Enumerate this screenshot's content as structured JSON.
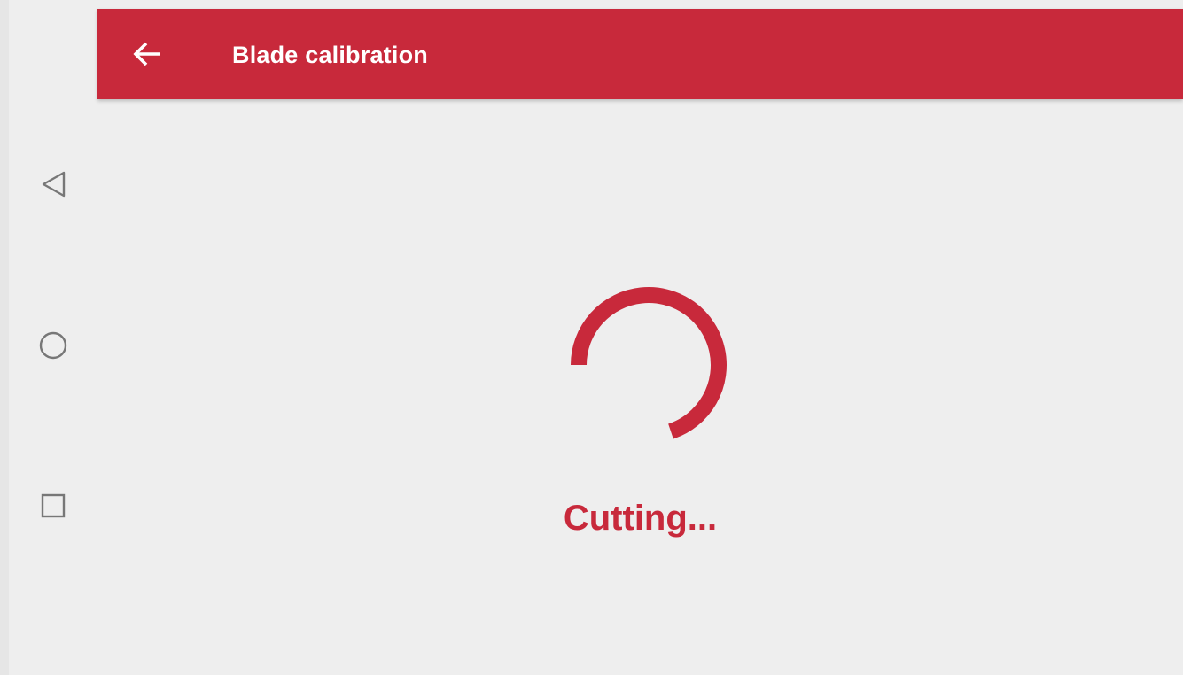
{
  "colors": {
    "accent": "#c8293b",
    "background": "#eeeeee",
    "app_bar_text": "#ffffff",
    "nav_icon": "#777777"
  },
  "nav_bar": {
    "icons": [
      "triangle-back-icon",
      "circle-home-icon",
      "square-recents-icon"
    ]
  },
  "app_bar": {
    "back_icon": "arrow-left-icon",
    "title": "Blade calibration"
  },
  "main": {
    "spinner_icon": "circular-progress-icon",
    "status_text": "Cutting..."
  }
}
